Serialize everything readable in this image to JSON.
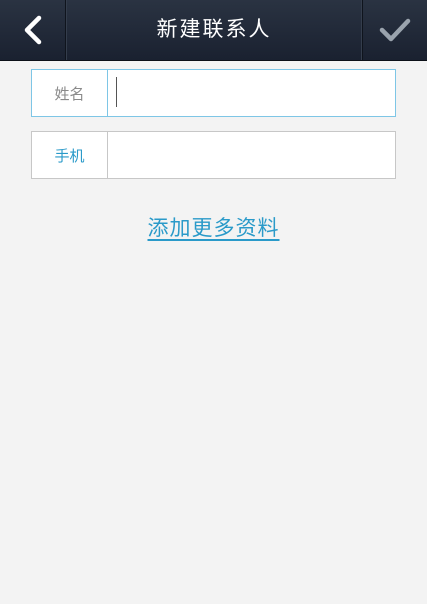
{
  "header": {
    "title": "新建联系人",
    "back_icon": "chevron-left-icon",
    "confirm_icon": "checkmark-icon"
  },
  "form": {
    "name": {
      "label": "姓名",
      "value": ""
    },
    "phone": {
      "label": "手机",
      "value": ""
    }
  },
  "more_link": "添加更多资料",
  "colors": {
    "header_bg": "#1f2735",
    "accent": "#2a9ac9",
    "focus_border": "#7ec6e6",
    "background": "#f3f3f3"
  }
}
